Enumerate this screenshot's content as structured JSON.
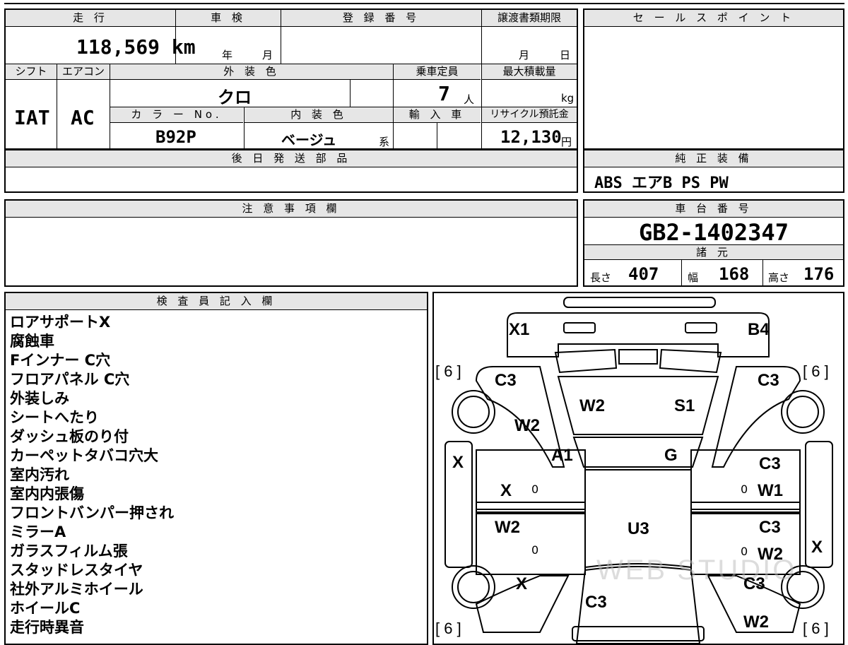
{
  "vehicle": {
    "mileage_label": "走 行",
    "mileage_value": "118,569 km",
    "shaken_label": "車 検",
    "shaken_year": "年",
    "shaken_month": "月",
    "reg_number_label": "登 録 番 号",
    "transfer_doc_label": "譲渡書類期限",
    "transfer_month": "月",
    "transfer_day": "日",
    "shift_label": "シフト",
    "shift_value": "IAT",
    "aircon_label": "エアコン",
    "aircon_value": "AC",
    "ext_color_label": "外 装 色",
    "ext_color_value": "クロ",
    "capacity_label": "乗車定員",
    "capacity_value": "7",
    "capacity_unit": "人",
    "max_load_label": "最大積載量",
    "max_load_unit": "kg",
    "color_no_label": "カ ラ ー No.",
    "color_no_value": "B92P",
    "int_color_label": "内 装 色",
    "int_color_value": "ベージュ",
    "int_color_suffix": "系",
    "import_label": "輸 入 車",
    "recycle_label": "リサイクル預託金",
    "recycle_value": "12,130",
    "recycle_unit": "円"
  },
  "sales_point": {
    "label": "セ ー ル ス ポ イ ン ト"
  },
  "later_parts": {
    "label": "後 日 発 送 部 品"
  },
  "standard_equipment": {
    "label": "純 正 装 備",
    "value": "ABS エアB PS PW"
  },
  "notes": {
    "label": "注 意 事 項 欄"
  },
  "chassis": {
    "label": "車 台 番 号",
    "value": "GB2-1402347"
  },
  "specs": {
    "label": "諸 元",
    "length_label": "長さ",
    "length_value": "407",
    "width_label": "幅",
    "width_value": "168",
    "height_label": "高さ",
    "height_value": "176"
  },
  "inspector": {
    "label": "検 査 員 記 入 欄",
    "items": [
      "ロアサポートX",
      "腐蝕車",
      "Fインナー C穴",
      "フロアパネル C穴",
      "外装しみ",
      "シートへたり",
      "ダッシュ板のり付",
      "カーペットタバコ穴大",
      "室内汚れ",
      "室内内張傷",
      "フロントバンパー押され",
      "ミラーA",
      "ガラスフィルム張",
      "スタッドレスタイヤ",
      "社外アルミホイール",
      "ホイールC",
      "走行時異音"
    ]
  },
  "diagram": {
    "tire_tl": "[ 6 ]",
    "tire_tr": "[ 6 ]",
    "tire_bl": "[ 6 ]",
    "tire_br": "[ 6 ]",
    "front_left": "X1",
    "front_right": "B4",
    "fender_fl": "C3",
    "fender_fr": "C3",
    "hood_left": "W2",
    "hood_right": "S1",
    "pillar_l": "W2",
    "windshield_l": "A1",
    "windshield_r": "G",
    "side_left": "X",
    "door_fl": "X",
    "door_fl_zero": "0",
    "door_rl": "W2",
    "door_rl_zero": "0",
    "door_fr_top": "C3",
    "door_fr": "W1",
    "door_fr_zero": "0",
    "door_rr_top": "C3",
    "door_rr": "W2",
    "door_rr_zero": "0",
    "side_right": "X",
    "roof": "U3",
    "quarter_l": "X",
    "quarter_r": "C3",
    "rear": "C3",
    "rear_r": "W2",
    "watermark": "WEB STUDIO"
  }
}
